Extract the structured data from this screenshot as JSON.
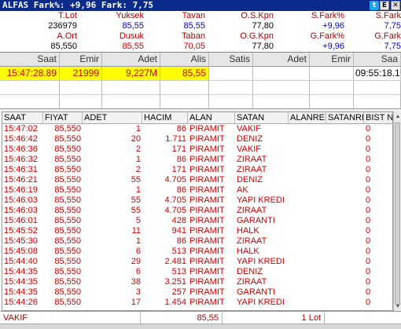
{
  "title": "ALFAS Fark%: +9,96  Fark: 7,75",
  "summary": {
    "row1_labels": [
      "T.Lot",
      "Yuksek",
      "Tavan",
      "O.S.Kpn",
      "S.Fark%",
      "S.Fark"
    ],
    "row1_values": [
      "236979",
      "85,55",
      "85,55",
      "77,80",
      "+9,96",
      "7,75"
    ],
    "row2_labels": [
      "A.Ort",
      "Dusuk",
      "Taban",
      "O.G.Kpn",
      "G.Fark%",
      "G.Fark"
    ],
    "row2_values": [
      "85,550",
      "85,55",
      "70,05",
      "77,80",
      "+9,96",
      "7,75"
    ]
  },
  "order": {
    "headers": [
      "Saat",
      "Emir",
      "Adet",
      "Alis",
      "Satis",
      "Adet",
      "Emir",
      "Saa"
    ],
    "row": [
      "15:47:28.89",
      "21999",
      "9,227M",
      "85,55",
      "",
      "",
      "",
      "09:55:18.1"
    ]
  },
  "trades": {
    "headers": [
      "SAAT",
      "FIYAT",
      "ADET",
      "HACIM",
      "ALAN",
      "SATAN",
      "ALANREF",
      "SATANREF",
      "BIST N"
    ],
    "rows": [
      [
        "15:47:02",
        "85,550",
        "1",
        "86",
        "PIRAMIT",
        "VAKIF",
        "",
        "",
        "0"
      ],
      [
        "15:46:42",
        "85,550",
        "20",
        "1.711",
        "PIRAMIT",
        "DENIZ",
        "",
        "",
        "0"
      ],
      [
        "15:46:36",
        "85,550",
        "2",
        "171",
        "PIRAMIT",
        "VAKIF",
        "",
        "",
        "0"
      ],
      [
        "15:46:32",
        "85,550",
        "1",
        "86",
        "PIRAMIT",
        "ZIRAAT",
        "",
        "",
        "0"
      ],
      [
        "15:46:31",
        "85,550",
        "2",
        "171",
        "PIRAMIT",
        "ZIRAAT",
        "",
        "",
        "0"
      ],
      [
        "15:46:21",
        "85,550",
        "55",
        "4.705",
        "PIRAMIT",
        "DENIZ",
        "",
        "",
        "0"
      ],
      [
        "15:46:19",
        "85,550",
        "1",
        "86",
        "PIRAMIT",
        "AK",
        "",
        "",
        "0"
      ],
      [
        "15:46:03",
        "85,550",
        "55",
        "4.705",
        "PIRAMIT",
        "YAPI KREDI",
        "",
        "",
        "0"
      ],
      [
        "15:46:03",
        "85,550",
        "55",
        "4.705",
        "PIRAMIT",
        "ZIRAAT",
        "",
        "",
        "0"
      ],
      [
        "15:46:01",
        "85,550",
        "5",
        "428",
        "PIRAMIT",
        "GARANTI",
        "",
        "",
        "0"
      ],
      [
        "15:45:52",
        "85,550",
        "11",
        "941",
        "PIRAMIT",
        "HALK",
        "",
        "",
        "0"
      ],
      [
        "15:45:30",
        "85,550",
        "1",
        "86",
        "PIRAMIT",
        "ZIRAAT",
        "",
        "",
        "0"
      ],
      [
        "15:45:08",
        "85,550",
        "6",
        "513",
        "PIRAMIT",
        "HALK",
        "",
        "",
        "0"
      ],
      [
        "15:44:40",
        "85,550",
        "29",
        "2.481",
        "PIRAMIT",
        "YAPI KREDI",
        "",
        "",
        "0"
      ],
      [
        "15:44:35",
        "85,550",
        "6",
        "513",
        "PIRAMIT",
        "DENIZ",
        "",
        "",
        "0"
      ],
      [
        "15:44:35",
        "85,550",
        "38",
        "3.251",
        "PIRAMIT",
        "ZIRAAT",
        "",
        "",
        "0"
      ],
      [
        "15:44:35",
        "85,550",
        "3",
        "257",
        "PIRAMIT",
        "GARANTI",
        "",
        "",
        "0"
      ],
      [
        "15:44:26",
        "85,550",
        "17",
        "1.454",
        "PIRAMIT",
        "YAPI KREDI",
        "",
        "",
        "0"
      ]
    ]
  },
  "footer": {
    "broker": "VAKIF",
    "price": "85,55",
    "lot": "1 Lot"
  },
  "icons": [
    "twitter-icon",
    "excel-icon",
    "close-icon"
  ]
}
